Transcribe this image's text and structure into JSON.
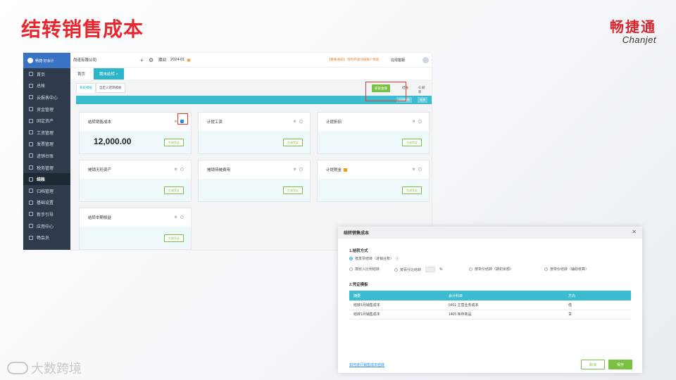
{
  "slide": {
    "title": "结转销售成本",
    "brand_cn": "畅捷通",
    "brand_en": "Chanjet",
    "watermark": "大数跨境"
  },
  "sidebar": {
    "logo_text": "畅捷·好会计",
    "items": [
      {
        "label": "首页",
        "icon": "home-icon"
      },
      {
        "label": "总账",
        "icon": "ledger-icon"
      },
      {
        "label": "云报表中心",
        "icon": "report-icon"
      },
      {
        "label": "资金管理",
        "icon": "funds-icon"
      },
      {
        "label": "固定资产",
        "icon": "asset-icon"
      },
      {
        "label": "工资管理",
        "icon": "salary-icon"
      },
      {
        "label": "发票管理",
        "icon": "invoice-icon"
      },
      {
        "label": "进销台账",
        "icon": "inventory-icon"
      },
      {
        "label": "税务管理",
        "icon": "tax-icon"
      },
      {
        "label": "结账",
        "icon": "checkout-icon"
      },
      {
        "label": "归档管理",
        "icon": "archive-icon"
      },
      {
        "label": "基础设置",
        "icon": "settings-icon"
      },
      {
        "label": "新手引导",
        "icon": "guide-icon"
      },
      {
        "label": "应用中心",
        "icon": "apps-icon"
      },
      {
        "label": "畅会员",
        "icon": "member-icon"
      }
    ],
    "active_index": 9
  },
  "topbar": {
    "company": "尚诺有限公司",
    "period_label": "期间",
    "period_value": "2024-01",
    "notice": "【重要通知】 限时开放注册账户体验",
    "help": "在线客服"
  },
  "tabs": [
    {
      "label": "首页"
    },
    {
      "label": "期末结转 ×"
    }
  ],
  "subtabs": [
    {
      "label": "系统模板"
    },
    {
      "label": "自定义结转模板"
    }
  ],
  "toolbar": {
    "fetch_label": "获取金额",
    "link_label": "结账",
    "refresh_label": "刷新",
    "options": [
      "自动结账",
      "全选"
    ]
  },
  "cards": [
    {
      "title": "结转销售成本",
      "amount": "12,000.00",
      "button": "生成凭证",
      "checked": true
    },
    {
      "title": "计提工资",
      "amount": "",
      "button": "生成凭证",
      "checked": false
    },
    {
      "title": "计提折旧",
      "amount": "",
      "button": "生成凭证",
      "checked": false
    },
    {
      "title": "摊销无形资产",
      "amount": "",
      "button": "生成凭证",
      "checked": false
    },
    {
      "title": "摊销待摊费用",
      "amount": "",
      "button": "生成凭证",
      "checked": false
    },
    {
      "title": "计提税金",
      "amount": "",
      "button": "生成凭证",
      "checked": false
    },
    {
      "title": "结转本期损益",
      "amount": "",
      "button": "生成凭证",
      "checked": false
    }
  ],
  "dialog": {
    "title": "结转销售成本",
    "section1": "1.结转方式",
    "opt_invoice": "按发票结转（进销台账）",
    "opt_ratio": "按收入比例结转",
    "opt_percent": "按百分比结转",
    "percent_unit": "%",
    "opt_unit_price": "按单价结转（期初余额）",
    "opt_unit_aux": "按单价结转（辅助核算）",
    "section2": "2.凭证模板",
    "table_headers": [
      "摘要",
      "会计科目",
      "方向"
    ],
    "table_rows": [
      [
        "结转1月销售成本",
        "5401 主营业务成本",
        "借"
      ],
      [
        "结转1月销售成本",
        "1405 库存商品",
        "贷"
      ]
    ],
    "link": "如何进行销售成本结转",
    "cancel": "取消",
    "save": "保存"
  }
}
